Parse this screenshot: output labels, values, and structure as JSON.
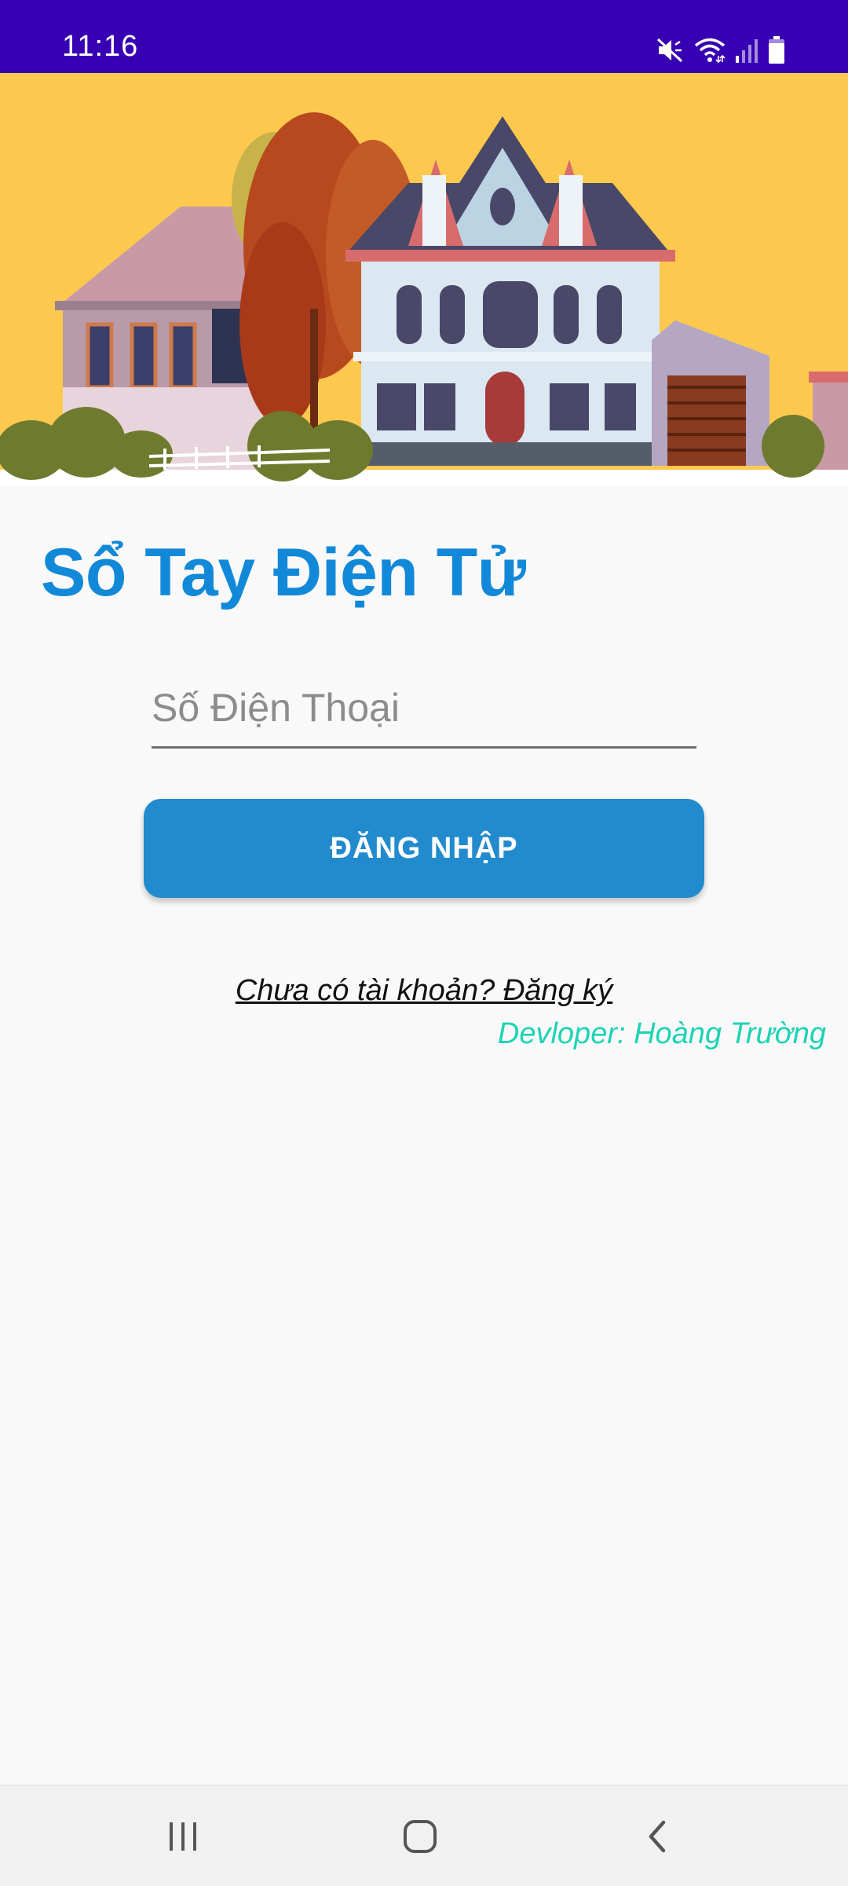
{
  "status_bar": {
    "time": "11:16",
    "icons": [
      "mute-icon",
      "wifi-icon",
      "signal-icon",
      "battery-icon"
    ]
  },
  "hero": {
    "image": "house-illustration"
  },
  "app": {
    "title": "Sổ Tay Điện Tử"
  },
  "login_form": {
    "phone_placeholder": "Số Điện Thoại",
    "phone_value": "",
    "login_label": "ĐĂNG NHẬP",
    "register_link": "Chưa có tài khoản? Đăng ký",
    "developer_credit": "Devloper: Hoàng Trường"
  },
  "nav_bar": {
    "buttons": [
      "recent-apps-icon",
      "home-icon",
      "back-icon"
    ]
  },
  "colors": {
    "status_bar": "#3700b3",
    "title": "#1289d8",
    "button": "#228bce",
    "credit": "#1cd3b4",
    "background": "#f9f9f9"
  }
}
